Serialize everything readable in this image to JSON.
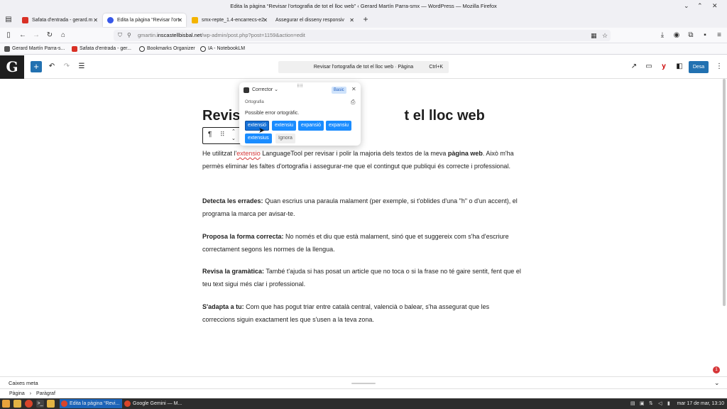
{
  "window": {
    "title": "Edita la pàgina “Revisar l'ortografia de tot el lloc web” ‹ Gerard Martín Parra-smx — WordPress — Mozilla Firefox"
  },
  "tabs": [
    {
      "label": "Safata d'entrada - gerard.m",
      "icon": "gmail-icon",
      "color": "#d93025"
    },
    {
      "label": "Edita la pàgina “Revisar l'ort",
      "icon": "wordpress-icon",
      "color": "#3858e9"
    },
    {
      "label": "smx-repte_1.4-encarrecs-e2",
      "icon": "drive-icon",
      "color": "#f4b400"
    },
    {
      "label": "Assegurar el disseny responsiv",
      "icon": "page-icon",
      "color": "#888888"
    }
  ],
  "url": {
    "prefix": "gmartin.",
    "domain": "inscastellbisbal.net",
    "path": "/wp-admin/post.php?post=1159&action=edit"
  },
  "bookmarks": [
    {
      "label": "Gerard Martín Parra-s...",
      "color": "#555555"
    },
    {
      "label": "Safata d'entrada - ger...",
      "color": "#d93025"
    },
    {
      "label": "Bookmarks Organizer",
      "color": "#333333"
    },
    {
      "label": "IA - NotebookLM",
      "color": "#333333"
    }
  ],
  "wp": {
    "command_bar": "Revisar l'ortografia de tot el lloc web · Pàgina",
    "command_shortcut": "Ctrl+K",
    "publish_label": "Desa",
    "page_title_visible": "Revisa",
    "page_title_tail": "t el lloc web"
  },
  "content": {
    "p1_before": "He utilitzat l'",
    "p1_error": "extensio",
    "p1_after": " LanguageTool per revisar i polir la majoria dels textos de la meva ",
    "p1_bold": "pàgina web",
    "p1_end": ". Això m'ha permès eliminar les faltes d'ortografia i assegurar-me que el contingut que publiqui és correcte i professional.",
    "p2_bold": "Detecta les errades:",
    "p2_text": " Quan escrius una paraula malament (per exemple, si t'oblides d'una \"h\" o d'un accent), el programa la marca per avisar-te.",
    "p3_bold": "Proposa la forma correcta:",
    "p3_text": " No només et diu que està malament, sinó que et suggereix com s'ha d'escriure correctament segons les normes de la llengua.",
    "p4_bold": "Revisa la gramàtica:",
    "p4_text": " També t'ajuda si has posat un article que no toca o si la frase no té gaire sentit, fent que el teu text sigui més clar i professional.",
    "p5_bold": "S'adapta a tu:",
    "p5_text": " Com que has pogut triar entre català central, valencià o balear, s'ha assegurat que les correccions siguin exactament les que s'usen a la teva zona."
  },
  "languagetool": {
    "title": "Corrector",
    "badge": "Basic",
    "category": "Ortografia",
    "message": "Possible error ortogràfic.",
    "suggestions": [
      "extensió",
      "extensiu",
      "expansió",
      "expansiu",
      "extensius"
    ],
    "ignore_label": "Ignora"
  },
  "footer": {
    "meta_boxes": "Caixes meta",
    "breadcrumb_page": "Pàgina",
    "breadcrumb_block": "Paràgraf",
    "notifications": "1"
  },
  "taskbar": {
    "tasks": [
      "Edita la pàgina “Revi...",
      "Google Gemini — M..."
    ],
    "clock": "mar 17 de mar, 13:10"
  }
}
